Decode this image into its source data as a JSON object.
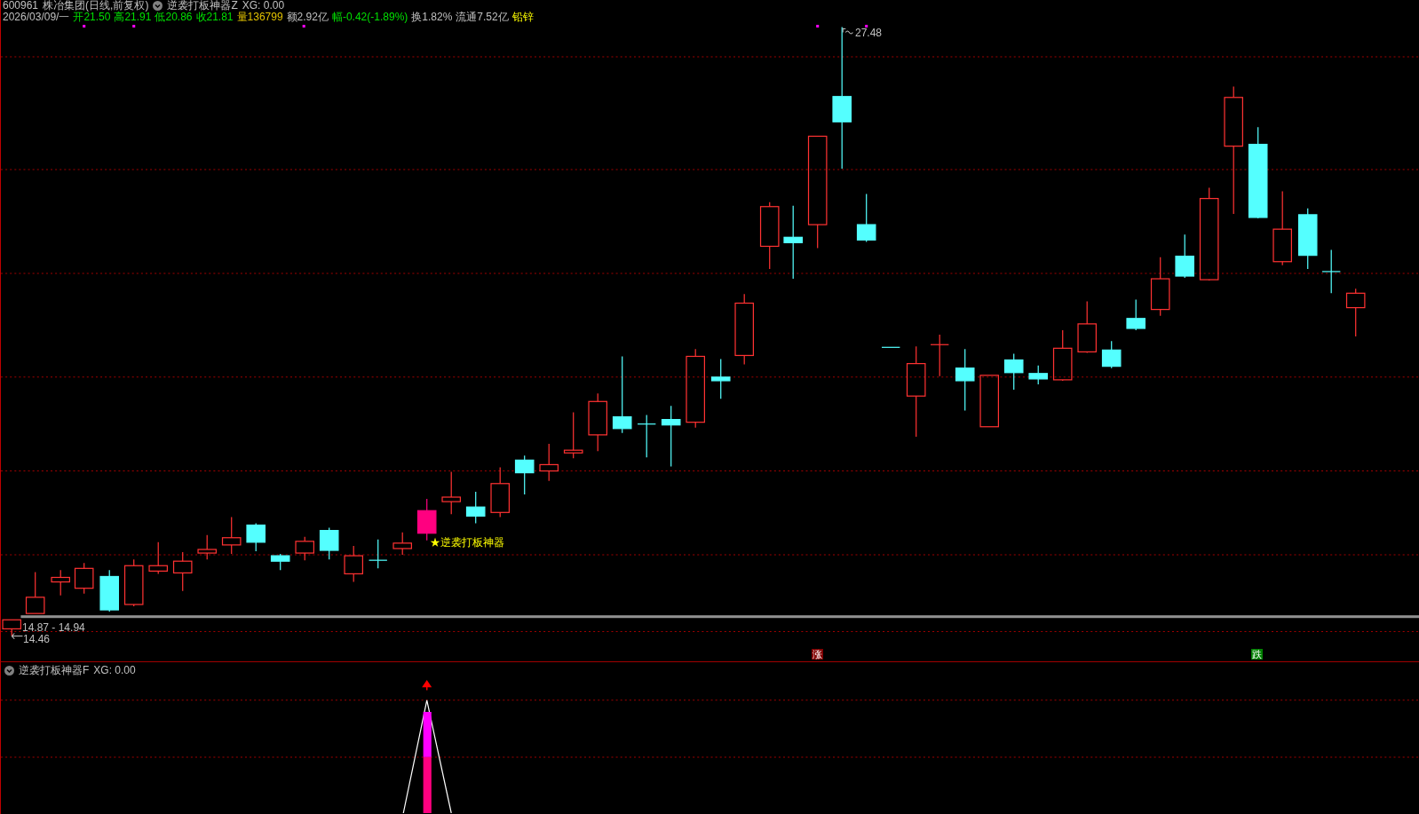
{
  "header": {
    "code": "600961",
    "name": "株冶集团(日线,前复权)",
    "indicator": "逆袭打板神器Z",
    "xg": "XG: 0.00"
  },
  "quote": [
    {
      "text": "2026/03/09/一",
      "kind": "neutral"
    },
    {
      "text": "开21.50",
      "kind": "price"
    },
    {
      "text": "高21.91",
      "kind": "price"
    },
    {
      "text": "低20.86",
      "kind": "price"
    },
    {
      "text": "收21.81",
      "kind": "price"
    },
    {
      "text": "量136799",
      "kind": "volume"
    },
    {
      "text": "额2.92亿",
      "kind": "neutral"
    },
    {
      "text": "幅-0.42(-1.89%)",
      "kind": "price"
    },
    {
      "text": "换1.82%",
      "kind": "neutral"
    },
    {
      "text": "流通7.52亿",
      "kind": "neutral"
    },
    {
      "text": "铅锌",
      "kind": "sector"
    }
  ],
  "chart": {
    "high_label": "27.48",
    "range_label": "14.87 - 14.94",
    "low_label": "14.46",
    "signal_label": "★逆袭打板神器",
    "markers": [
      {
        "text": "涨",
        "color": "#800000"
      },
      {
        "text": "跌",
        "color": "#008000"
      }
    ]
  },
  "lower_panel": {
    "indicator": "逆袭打板神器F",
    "xg": "XG: 0.00"
  }
}
